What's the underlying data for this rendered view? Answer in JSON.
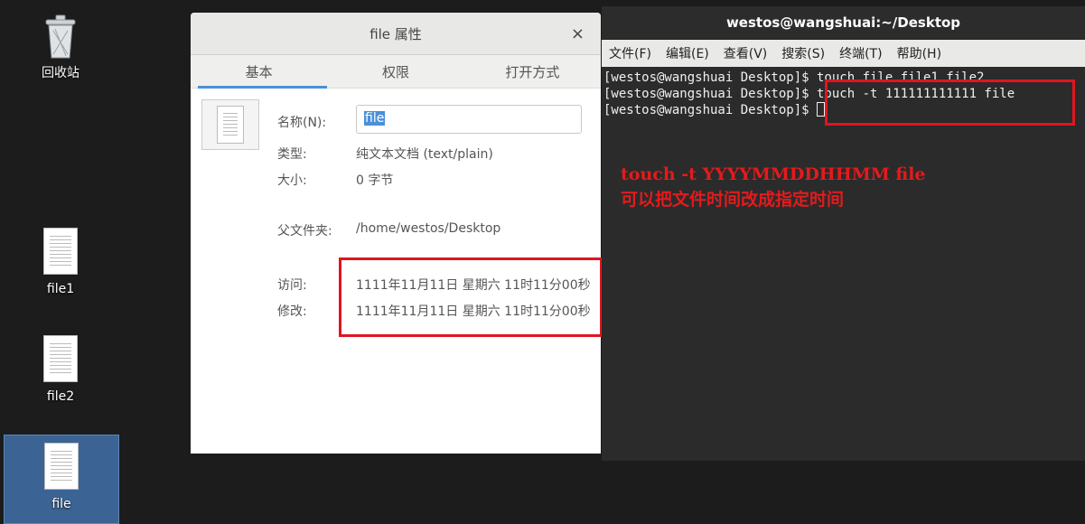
{
  "desktop": {
    "icons": [
      {
        "label": "回收站"
      },
      {
        "label": "file1"
      },
      {
        "label": "file2"
      },
      {
        "label": "file"
      }
    ]
  },
  "properties": {
    "title": "file 属性",
    "close": "×",
    "tabs": [
      "基本",
      "权限",
      "打开方式"
    ],
    "name_label": "名称(N):",
    "name_value": "file",
    "type_label": "类型:",
    "type_value": "纯文本文档 (text/plain)",
    "size_label": "大小:",
    "size_value": "0 字节",
    "parent_label": "父文件夹:",
    "parent_value": "/home/westos/Desktop",
    "access_label": "访问:",
    "access_value": "1111年11月11日 星期六 11时11分00秒",
    "modified_label": "修改:",
    "modified_value": "1111年11月11日 星期六 11时11分00秒"
  },
  "terminal": {
    "title": "westos@wangshuai:~/Desktop",
    "menu": [
      "文件(F)",
      "编辑(E)",
      "查看(V)",
      "搜索(S)",
      "终端(T)",
      "帮助(H)"
    ],
    "lines": [
      "[westos@wangshuai Desktop]$ touch file file1 file2",
      "[westos@wangshuai Desktop]$ touch -t 111111111111 file",
      "[westos@wangshuai Desktop]$ "
    ]
  },
  "annotation": {
    "line1": "touch -t YYYYMMDDHHMM file",
    "line2": "可以把文件时间改成指定时间",
    "color": "#e41a1c"
  }
}
